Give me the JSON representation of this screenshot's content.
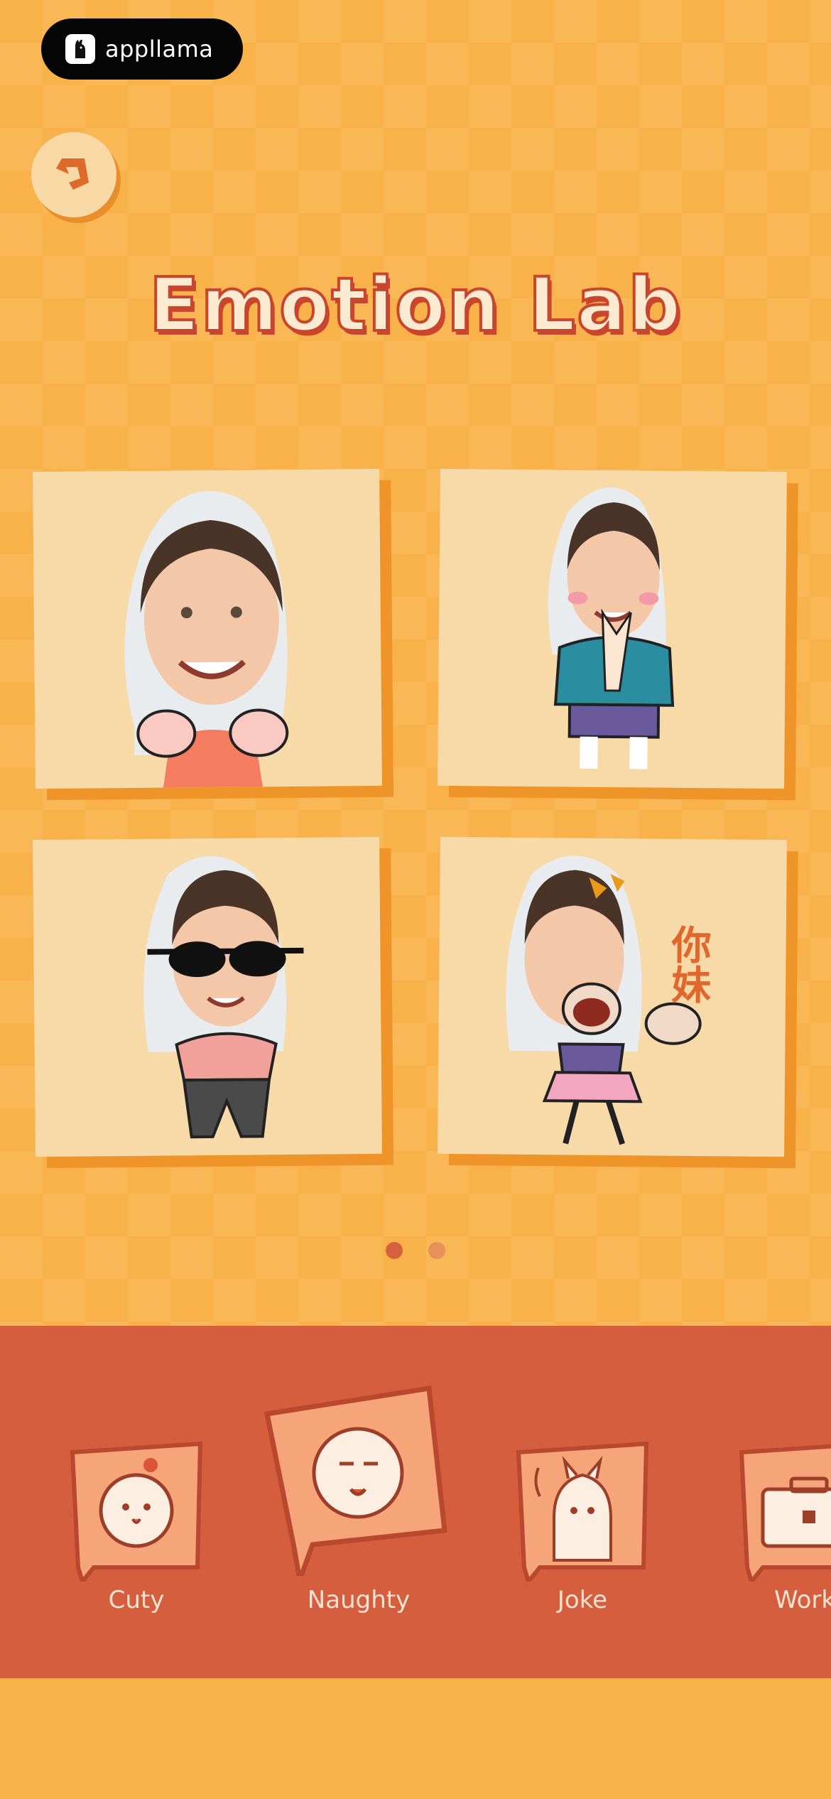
{
  "app_badge": {
    "name": "appllama"
  },
  "page_title": "Emotion Lab",
  "pager": {
    "pages": 2,
    "active": 1
  },
  "stickers": [
    {
      "id": "sticker-1",
      "caption": ""
    },
    {
      "id": "sticker-2",
      "caption": ""
    },
    {
      "id": "sticker-3",
      "caption": ""
    },
    {
      "id": "sticker-4",
      "caption": "你妹"
    }
  ],
  "categories": [
    {
      "label": "Cuty",
      "icon": "cute-face-icon"
    },
    {
      "label": "Naughty",
      "icon": "naughty-face-icon"
    },
    {
      "label": "Joke",
      "icon": "llama-icon"
    },
    {
      "label": "Work",
      "icon": "briefcase-icon"
    }
  ],
  "colors": {
    "background": "#F9B24A",
    "category_bar": "#D55E3E",
    "card": "#F8D9A8",
    "title_fill": "#FCEBD0",
    "title_stroke": "#C9462E",
    "dot_active": "#D6613F",
    "dot_inactive": "#E7915A"
  }
}
